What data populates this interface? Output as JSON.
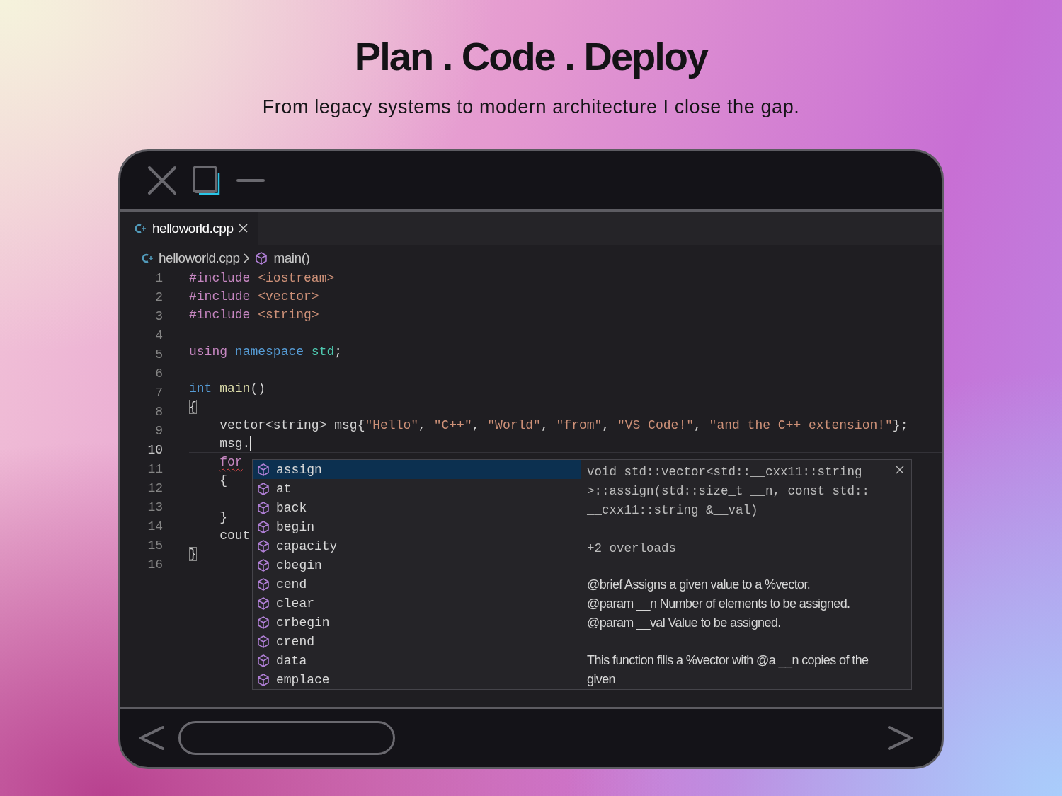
{
  "headline": "Plan . Code . Deploy",
  "tagline": "From legacy systems to modern architecture I close the gap.",
  "tabs": [
    {
      "label": "helloworld.cpp",
      "selected": true
    }
  ],
  "breadcrumb": [
    {
      "label": "helloworld.cpp",
      "kind": "file"
    },
    {
      "label": "main()",
      "kind": "symbol"
    }
  ],
  "lines": [
    {
      "number": "1",
      "current": false,
      "tokens": [
        {
          "text": "#include",
          "kind": "keyword"
        },
        {
          "text": " <iostream>",
          "kind": "string"
        }
      ]
    },
    {
      "number": "2",
      "current": false,
      "tokens": [
        {
          "text": "#include",
          "kind": "keyword"
        },
        {
          "text": " <vector>",
          "kind": "string"
        }
      ]
    },
    {
      "number": "3",
      "current": false,
      "tokens": [
        {
          "text": "#include",
          "kind": "keyword"
        },
        {
          "text": " <string>",
          "kind": "string"
        }
      ]
    },
    {
      "number": "4",
      "current": false
    },
    {
      "number": "5",
      "current": false,
      "tokens": [
        {
          "text": "using",
          "kind": "keyword"
        },
        {
          "text": " namespace",
          "kind": "type"
        },
        {
          "text": " std",
          "kind": "namespace"
        },
        {
          "text": ";",
          "kind": "plain"
        }
      ]
    },
    {
      "number": "6",
      "current": false
    },
    {
      "number": "7",
      "current": false,
      "tokens": [
        {
          "text": "int",
          "kind": "type"
        },
        {
          "text": " main",
          "kind": "function"
        },
        {
          "text": "()",
          "kind": "plain"
        }
      ]
    },
    {
      "number": "8",
      "current": false,
      "tokens": [
        {
          "text": "{",
          "kind": "match"
        }
      ]
    },
    {
      "number": "9",
      "current": false,
      "tokens": [
        {
          "text": "    vector<string> msg{",
          "kind": "plain"
        },
        {
          "text": "\"Hello\"",
          "kind": "string"
        },
        {
          "text": ", ",
          "kind": "plain"
        },
        {
          "text": "\"C++\"",
          "kind": "string"
        },
        {
          "text": ", ",
          "kind": "plain"
        },
        {
          "text": "\"World\"",
          "kind": "string"
        },
        {
          "text": ", ",
          "kind": "plain"
        },
        {
          "text": "\"from\"",
          "kind": "string"
        },
        {
          "text": ", ",
          "kind": "plain"
        },
        {
          "text": "\"VS Code!\"",
          "kind": "string"
        },
        {
          "text": ", ",
          "kind": "plain"
        },
        {
          "text": "\"and the C++ extension!\"",
          "kind": "string"
        },
        {
          "text": "};",
          "kind": "plain"
        }
      ]
    },
    {
      "number": "10",
      "current": true,
      "tokens": [
        {
          "text": "    msg.",
          "kind": "plain"
        }
      ]
    },
    {
      "number": "11",
      "current": false,
      "tokens": [
        {
          "text": "    for",
          "kind": "error"
        }
      ]
    },
    {
      "number": "12",
      "current": false,
      "tokens": [
        {
          "text": "    {",
          "kind": "plain"
        }
      ]
    },
    {
      "number": "13",
      "current": false
    },
    {
      "number": "14",
      "current": false,
      "tokens": [
        {
          "text": "    }",
          "kind": "plain"
        }
      ]
    },
    {
      "number": "15",
      "current": false,
      "tokens": [
        {
          "text": "    cout",
          "kind": "plain"
        }
      ]
    },
    {
      "number": "16",
      "current": false,
      "tokens": [
        {
          "text": "}",
          "kind": "match"
        }
      ]
    }
  ],
  "suggestions": [
    {
      "label": "assign",
      "selected": true
    },
    {
      "label": "at",
      "selected": false
    },
    {
      "label": "back",
      "selected": false
    },
    {
      "label": "begin",
      "selected": false
    },
    {
      "label": "capacity",
      "selected": false
    },
    {
      "label": "cbegin",
      "selected": false
    },
    {
      "label": "cend",
      "selected": false
    },
    {
      "label": "clear",
      "selected": false
    },
    {
      "label": "crbegin",
      "selected": false
    },
    {
      "label": "crend",
      "selected": false
    },
    {
      "label": "data",
      "selected": false
    },
    {
      "label": "emplace",
      "selected": false
    }
  ],
  "details": {
    "signature": [
      "void std::vector<std::__cxx11::string",
      ">::assign(std::size_t __n, const std::",
      "__cxx11::string &__val)"
    ],
    "overloads": "+2 overloads",
    "doc": [
      "@brief Assigns a given value to a %vector.",
      "@param __n Number of elements to be assigned.",
      "@param __val Value to be assigned."
    ],
    "description": "This function fills a %vector with @a __n copies of the given"
  }
}
